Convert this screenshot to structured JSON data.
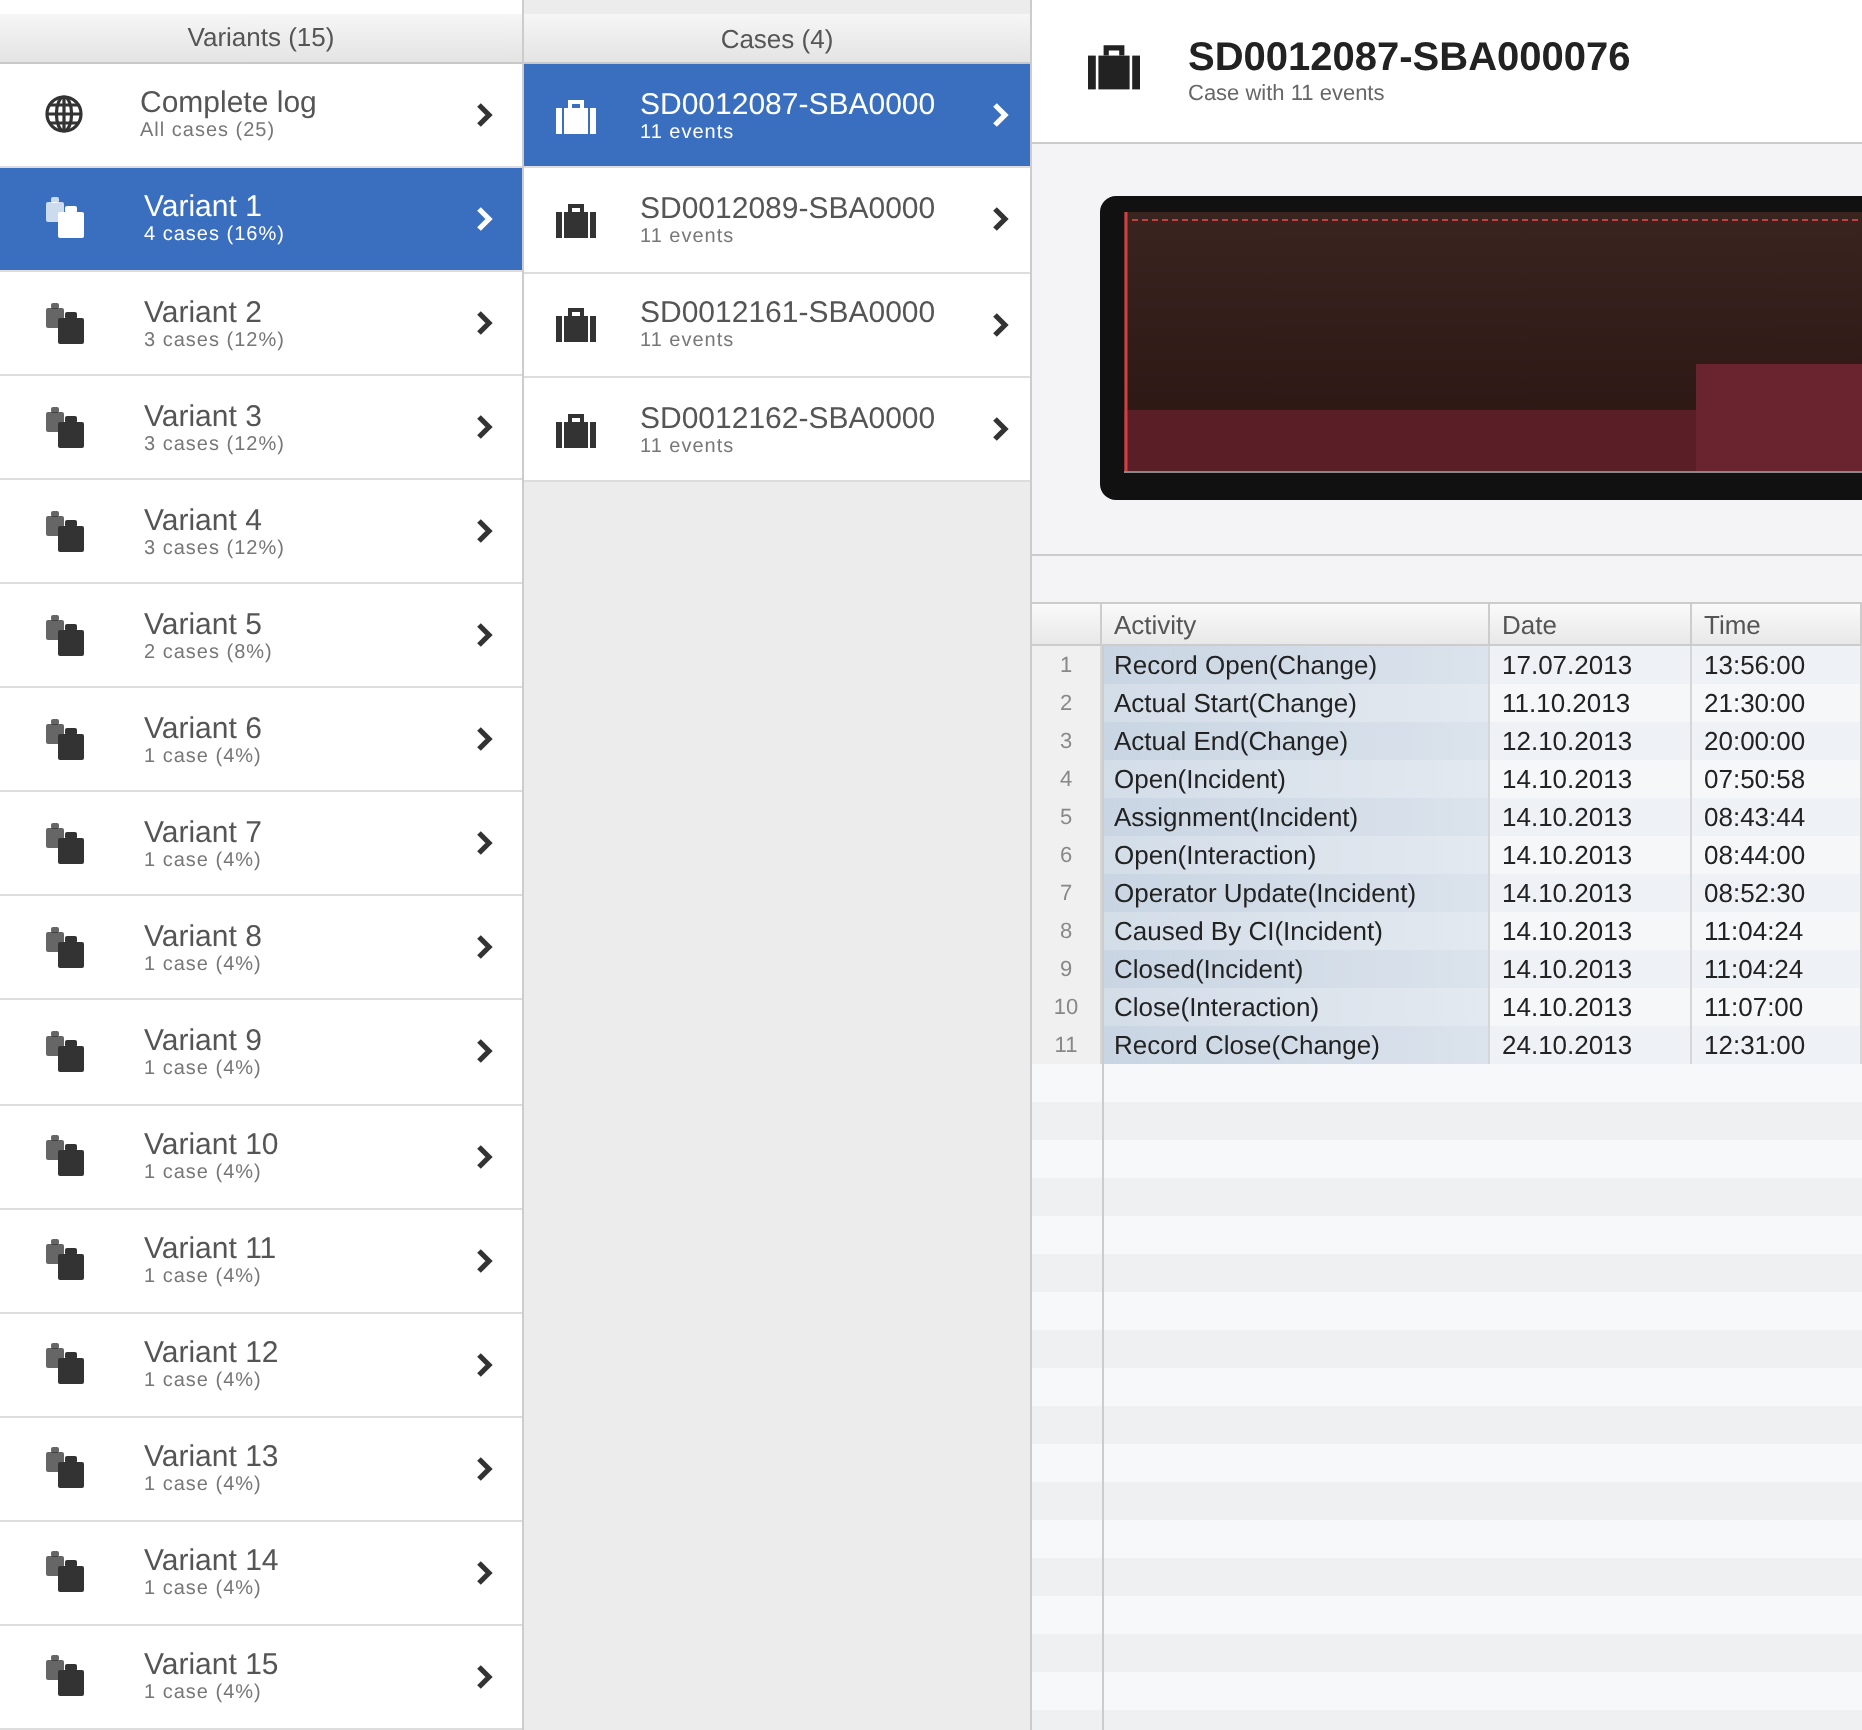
{
  "variants_panel": {
    "heading": "Variants (15)",
    "items": [
      {
        "kind": "log",
        "title": "Complete log",
        "subtitle": "All cases (25)",
        "selected": false
      },
      {
        "kind": "variant",
        "title": "Variant 1",
        "subtitle": "4 cases (16%)",
        "selected": true
      },
      {
        "kind": "variant",
        "title": "Variant 2",
        "subtitle": "3 cases (12%)",
        "selected": false
      },
      {
        "kind": "variant",
        "title": "Variant 3",
        "subtitle": "3 cases (12%)",
        "selected": false
      },
      {
        "kind": "variant",
        "title": "Variant 4",
        "subtitle": "3 cases (12%)",
        "selected": false
      },
      {
        "kind": "variant",
        "title": "Variant 5",
        "subtitle": "2 cases (8%)",
        "selected": false
      },
      {
        "kind": "variant",
        "title": "Variant 6",
        "subtitle": "1 case (4%)",
        "selected": false
      },
      {
        "kind": "variant",
        "title": "Variant 7",
        "subtitle": "1 case (4%)",
        "selected": false
      },
      {
        "kind": "variant",
        "title": "Variant 8",
        "subtitle": "1 case (4%)",
        "selected": false
      },
      {
        "kind": "variant",
        "title": "Variant 9",
        "subtitle": "1 case (4%)",
        "selected": false
      },
      {
        "kind": "variant",
        "title": "Variant 10",
        "subtitle": "1 case (4%)",
        "selected": false
      },
      {
        "kind": "variant",
        "title": "Variant 11",
        "subtitle": "1 case (4%)",
        "selected": false
      },
      {
        "kind": "variant",
        "title": "Variant 12",
        "subtitle": "1 case (4%)",
        "selected": false
      },
      {
        "kind": "variant",
        "title": "Variant 13",
        "subtitle": "1 case (4%)",
        "selected": false
      },
      {
        "kind": "variant",
        "title": "Variant 14",
        "subtitle": "1 case (4%)",
        "selected": false
      },
      {
        "kind": "variant",
        "title": "Variant 15",
        "subtitle": "1 case (4%)",
        "selected": false
      }
    ]
  },
  "cases_panel": {
    "heading": "Cases (4)",
    "items": [
      {
        "title": "SD0012087-SBA0000",
        "subtitle": "11 events",
        "selected": true
      },
      {
        "title": "SD0012089-SBA0000",
        "subtitle": "11 events",
        "selected": false
      },
      {
        "title": "SD0012161-SBA0000",
        "subtitle": "11 events",
        "selected": false
      },
      {
        "title": "SD0012162-SBA0000",
        "subtitle": "11 events",
        "selected": false
      }
    ]
  },
  "case_detail": {
    "title": "SD0012087-SBA000076",
    "subtitle": "Case with 11 events",
    "table": {
      "columns": [
        "",
        "Activity",
        "Date",
        "Time"
      ],
      "rows": [
        [
          "1",
          "Record Open(Change)",
          "17.07.2013",
          "13:56:00"
        ],
        [
          "2",
          "Actual Start(Change)",
          "11.10.2013",
          "21:30:00"
        ],
        [
          "3",
          "Actual End(Change)",
          "12.10.2013",
          "20:00:00"
        ],
        [
          "4",
          "Open(Incident)",
          "14.10.2013",
          "07:50:58"
        ],
        [
          "5",
          "Assignment(Incident)",
          "14.10.2013",
          "08:43:44"
        ],
        [
          "6",
          "Open(Interaction)",
          "14.10.2013",
          "08:44:00"
        ],
        [
          "7",
          "Operator Update(Incident)",
          "14.10.2013",
          "08:52:30"
        ],
        [
          "8",
          "Caused By CI(Incident)",
          "14.10.2013",
          "11:04:24"
        ],
        [
          "9",
          "Closed(Incident)",
          "14.10.2013",
          "11:04:24"
        ],
        [
          "10",
          "Close(Interaction)",
          "14.10.2013",
          "11:07:00"
        ],
        [
          "11",
          "Record Close(Change)",
          "24.10.2013",
          "12:31:00"
        ]
      ]
    }
  }
}
